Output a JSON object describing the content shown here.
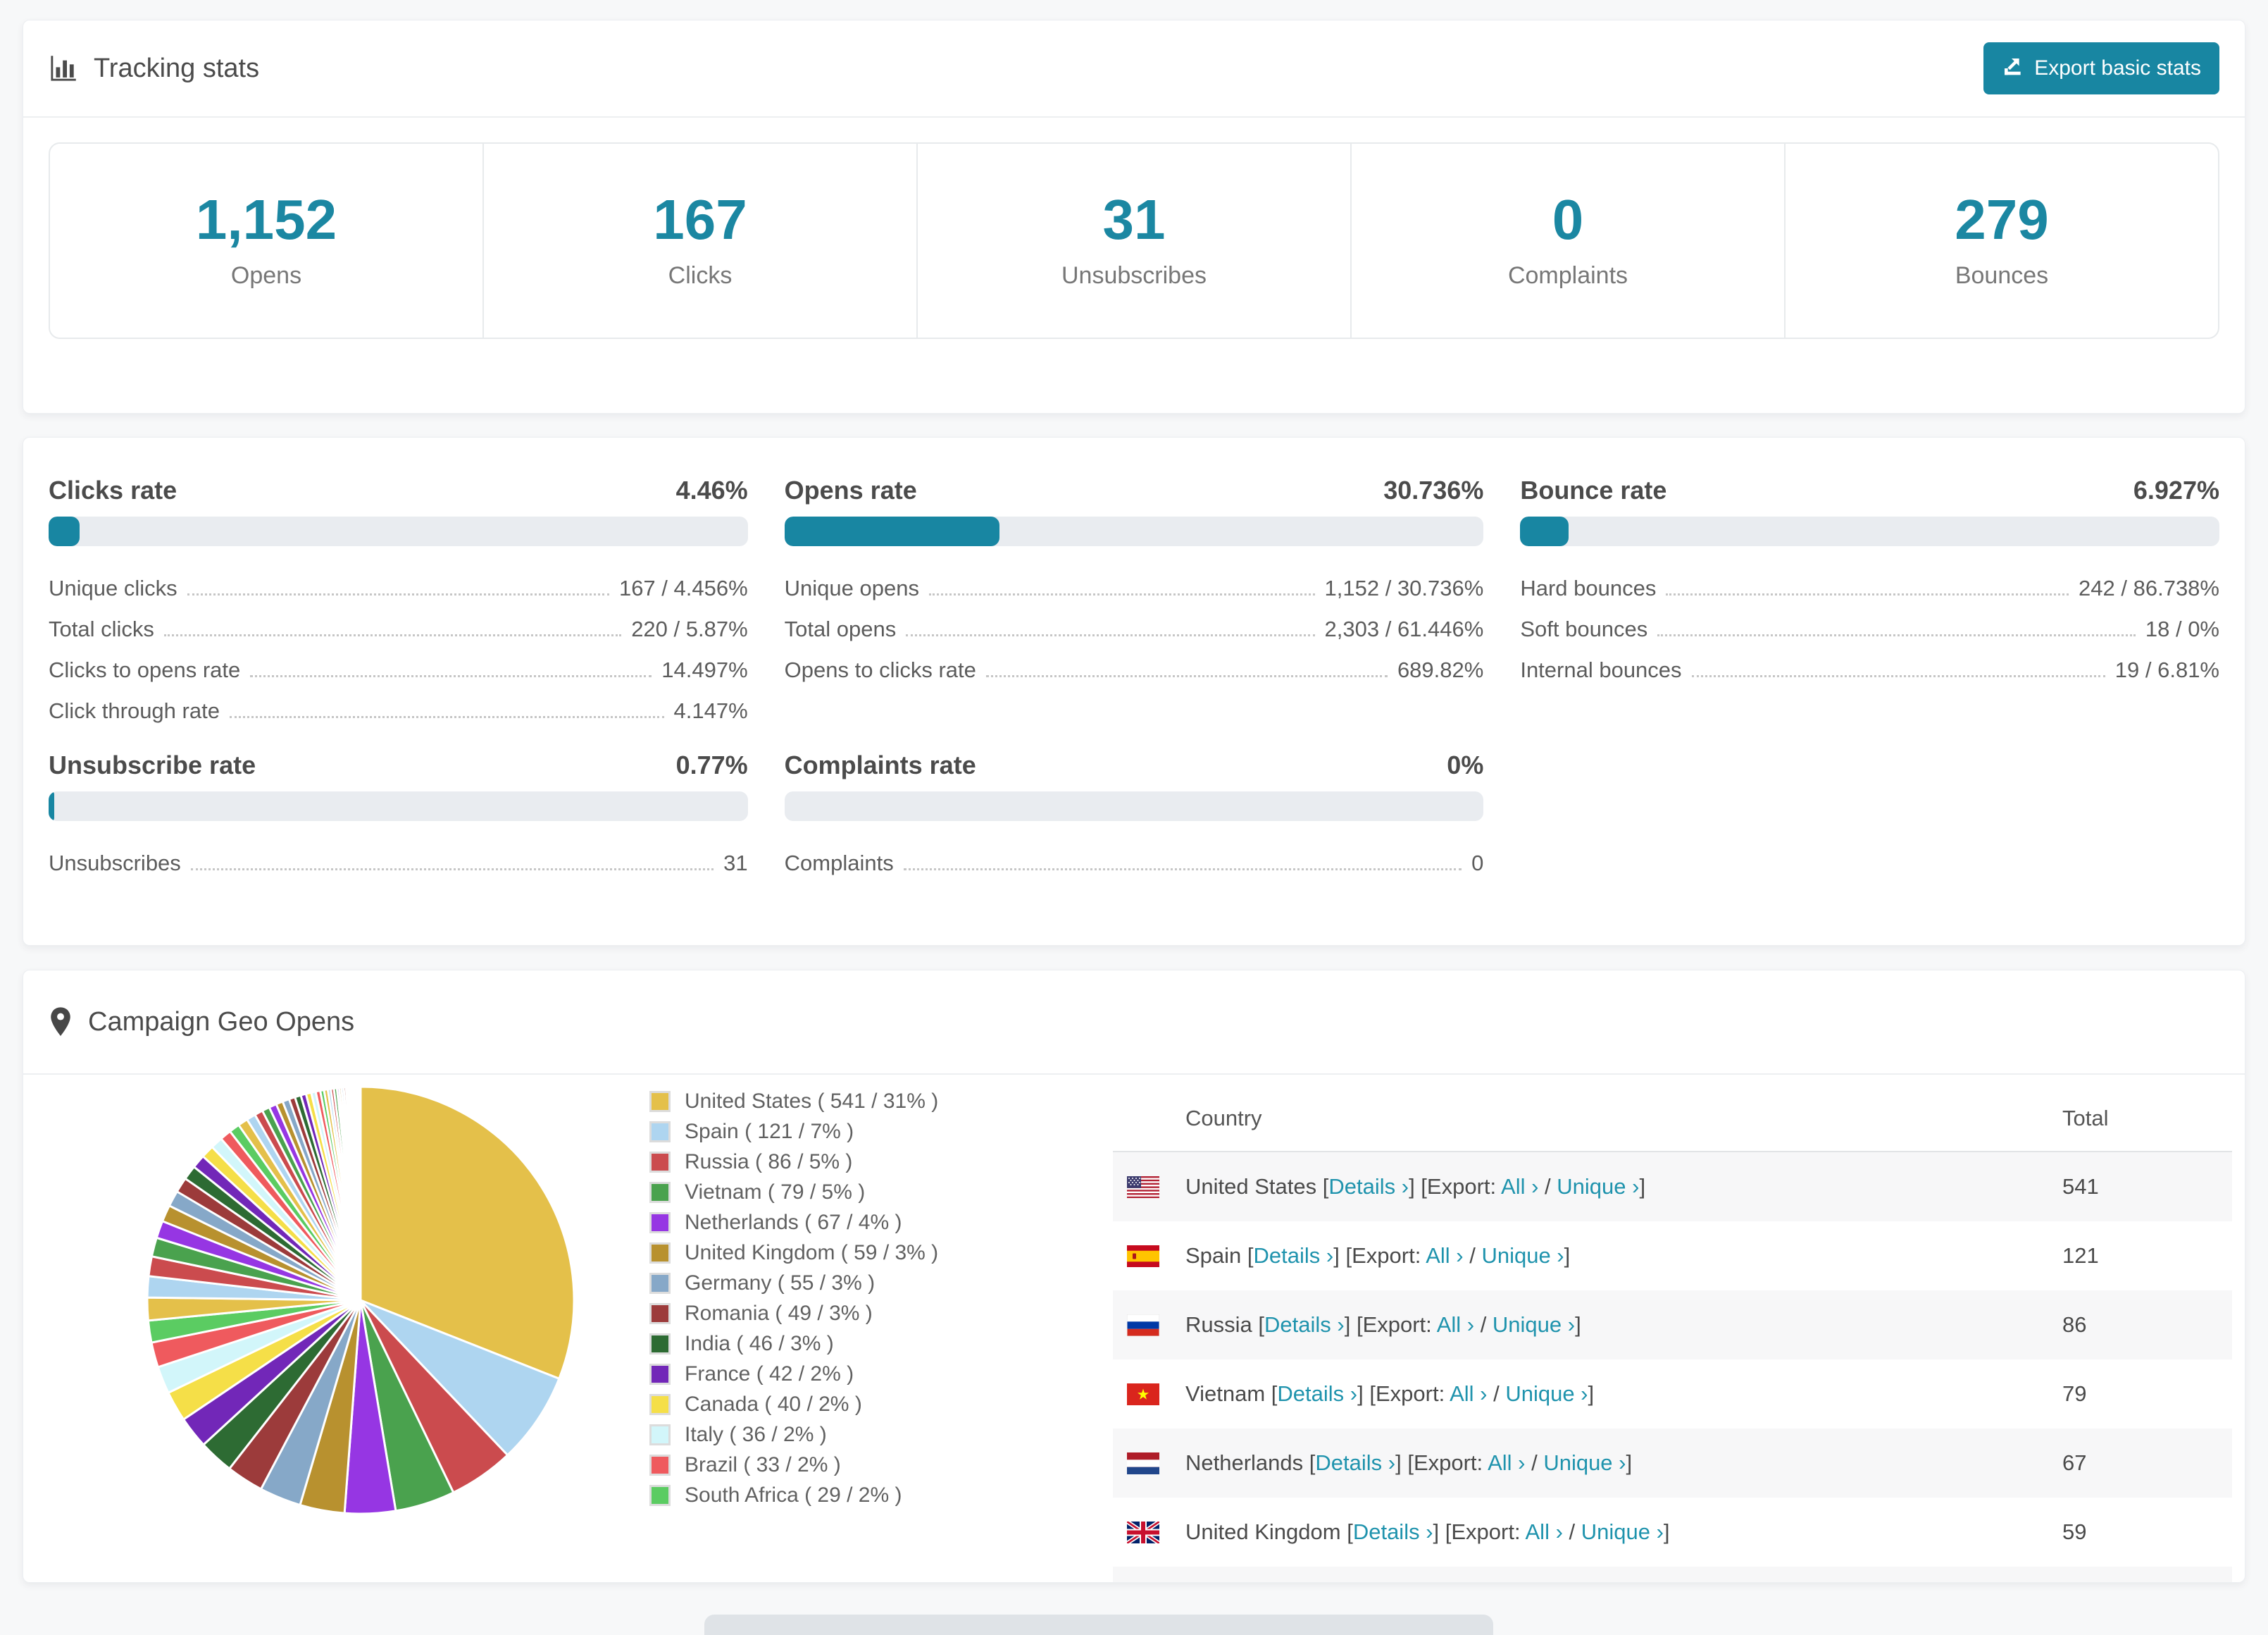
{
  "colors": {
    "accent": "#1886a2",
    "link": "#1f93ad",
    "bar_track": "#e9ecf0",
    "stat_number": "#1b87a2"
  },
  "header": {
    "icon": "bar-chart-icon",
    "title": "Tracking stats",
    "export_button": "Export basic stats"
  },
  "summary_stats": [
    {
      "value": "1,152",
      "label": "Opens"
    },
    {
      "value": "167",
      "label": "Clicks"
    },
    {
      "value": "31",
      "label": "Unsubscribes"
    },
    {
      "value": "0",
      "label": "Complaints"
    },
    {
      "value": "279",
      "label": "Bounces"
    }
  ],
  "rate_panels": [
    {
      "title": "Clicks rate",
      "value": "4.46%",
      "percent": 4.46,
      "rows": [
        [
          "Unique clicks",
          "167 / 4.456%"
        ],
        [
          "Total clicks",
          "220 / 5.87%"
        ],
        [
          "Clicks to opens rate",
          "14.497%"
        ],
        [
          "Click through rate",
          "4.147%"
        ]
      ]
    },
    {
      "title": "Opens rate",
      "value": "30.736%",
      "percent": 30.736,
      "rows": [
        [
          "Unique opens",
          "1,152 / 30.736%"
        ],
        [
          "Total opens",
          "2,303 / 61.446%"
        ],
        [
          "Opens to clicks rate",
          "689.82%"
        ]
      ]
    },
    {
      "title": "Bounce rate",
      "value": "6.927%",
      "percent": 6.927,
      "rows": [
        [
          "Hard bounces",
          "242 / 86.738%"
        ],
        [
          "Soft bounces",
          "18 / 0%"
        ],
        [
          "Internal bounces",
          "19 / 6.81%"
        ]
      ]
    },
    {
      "title": "Unsubscribe rate",
      "value": "0.77%",
      "percent": 0.77,
      "rows": [
        [
          "Unsubscribes",
          "31"
        ]
      ]
    },
    {
      "title": "Complaints rate",
      "value": "0%",
      "percent": 0,
      "rows": [
        [
          "Complaints",
          "0"
        ]
      ]
    }
  ],
  "geo": {
    "icon": "map-marker-icon",
    "title": "Campaign Geo Opens",
    "chart_data": {
      "type": "pie",
      "title": "Campaign Geo Opens",
      "legend_position": "right",
      "start_angle": 0,
      "series": [
        {
          "label": "United States",
          "value": 541,
          "percent": 31,
          "color": "#e4c04a"
        },
        {
          "label": "Spain",
          "value": 121,
          "percent": 7,
          "color": "#aed5f0"
        },
        {
          "label": "Russia",
          "value": 86,
          "percent": 5,
          "color": "#cb4b4e"
        },
        {
          "label": "Vietnam",
          "value": 79,
          "percent": 5,
          "color": "#4aa24e"
        },
        {
          "label": "Netherlands",
          "value": 67,
          "percent": 4,
          "color": "#9636e3"
        },
        {
          "label": "United Kingdom",
          "value": 59,
          "percent": 3,
          "color": "#b8912f"
        },
        {
          "label": "Germany",
          "value": 55,
          "percent": 3,
          "color": "#86a8c8"
        },
        {
          "label": "Romania",
          "value": 49,
          "percent": 3,
          "color": "#9c3b3b"
        },
        {
          "label": "India",
          "value": 46,
          "percent": 3,
          "color": "#2d6b33"
        },
        {
          "label": "France",
          "value": 42,
          "percent": 2,
          "color": "#7227b8"
        },
        {
          "label": "Canada",
          "value": 40,
          "percent": 2,
          "color": "#f5df48"
        },
        {
          "label": "Italy",
          "value": 36,
          "percent": 2,
          "color": "#d2f6fa"
        },
        {
          "label": "Brazil",
          "value": 33,
          "percent": 2,
          "color": "#ef5a5e"
        },
        {
          "label": "South Africa",
          "value": 29,
          "percent": 2,
          "color": "#5bcc62"
        }
      ],
      "others_tail_approx": [
        30,
        28,
        26,
        25,
        23,
        22,
        21,
        20,
        19,
        18,
        17,
        16,
        15,
        14,
        13,
        12,
        11,
        10,
        10,
        9,
        9,
        8,
        8,
        7,
        7,
        6,
        6,
        5,
        5,
        4,
        4,
        4,
        3,
        3,
        3,
        3,
        2,
        2,
        2,
        2,
        2,
        1,
        1,
        1,
        1,
        1,
        1,
        1,
        1,
        1
      ],
      "total_approx": 1745
    },
    "table": {
      "columns": [
        "Country",
        "Total"
      ],
      "link_text": {
        "open_bracket": "[",
        "close_bracket": "]",
        "details": "Details ›",
        "export_prefix": "Export:",
        "all": "All ›",
        "separator": "/",
        "unique": "Unique ›"
      },
      "rows": [
        {
          "flag": "us",
          "country": "United States",
          "total": "541"
        },
        {
          "flag": "es",
          "country": "Spain",
          "total": "121"
        },
        {
          "flag": "ru",
          "country": "Russia",
          "total": "86"
        },
        {
          "flag": "vn",
          "country": "Vietnam",
          "total": "79"
        },
        {
          "flag": "nl",
          "country": "Netherlands",
          "total": "67"
        },
        {
          "flag": "gb",
          "country": "United Kingdom",
          "total": "59"
        },
        {
          "flag": "de",
          "country": "",
          "total": "",
          "partial": true
        }
      ]
    }
  }
}
